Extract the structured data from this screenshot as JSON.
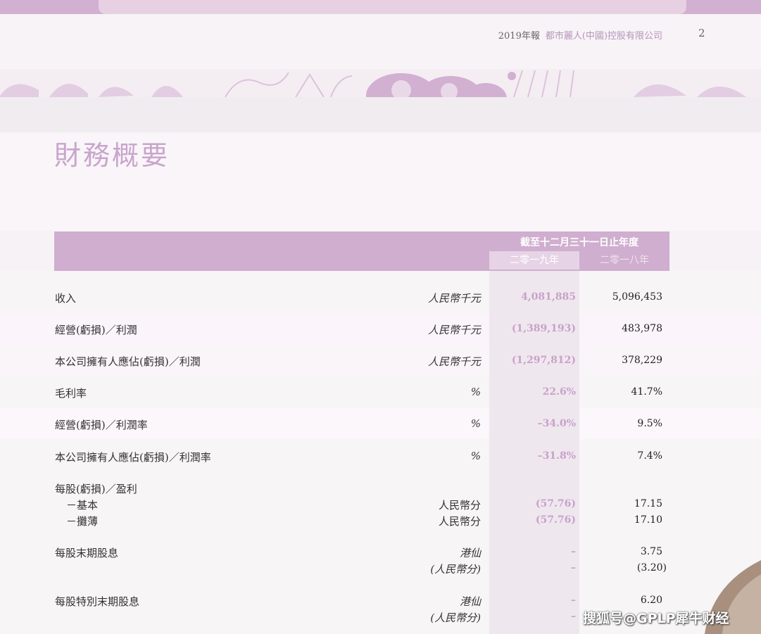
{
  "header": {
    "report": "2019年報",
    "company": "都市麗人(中國)控股有限公司",
    "page": "2"
  },
  "title": "財務概要",
  "table": {
    "period": "截至十二月三十一日止年度",
    "year_2019": "二零一九年",
    "year_2018": "二零一八年",
    "rows": [
      {
        "label": "收入",
        "unit": "人民幣千元",
        "v2019": "4,081,885",
        "v2018": "5,096,453"
      },
      {
        "label": "經營(虧損)／利潤",
        "unit": "人民幣千元",
        "v2019": "(1,389,193)",
        "v2018": "483,978"
      },
      {
        "label": "本公司擁有人應佔(虧損)／利潤",
        "unit": "人民幣千元",
        "v2019": "(1,297,812)",
        "v2018": "378,229"
      },
      {
        "label": "毛利率",
        "unit": "%",
        "v2019": "22.6%",
        "v2018": "41.7%"
      },
      {
        "label": "經營(虧損)／利潤率",
        "unit": "%",
        "v2019": "–34.0%",
        "v2018": "9.5%"
      },
      {
        "label": "本公司擁有人應佔(虧損)／利潤率",
        "unit": "%",
        "v2019": "–31.8%",
        "v2018": "7.4%"
      }
    ],
    "eps": {
      "label": "每股(虧損)／盈利",
      "basic": {
        "label": "－基本",
        "unit": "人民幣分",
        "v2019": "(57.76)",
        "v2018": "17.15"
      },
      "diluted": {
        "label": "－攤薄",
        "unit": "人民幣分",
        "v2019": "(57.76)",
        "v2018": "17.10"
      }
    },
    "final_dividend": {
      "label": "每股末期股息",
      "unit1": "港仙",
      "unit2": "(人民幣分)",
      "v2019_1": "–",
      "v2019_2": "–",
      "v2018_1": "3.75",
      "v2018_2": "(3.20)"
    },
    "special_dividend": {
      "label": "每股特別末期股息",
      "unit1": "港仙",
      "unit2": "(人民幣分)",
      "v2019_1": "–",
      "v2019_2": "–",
      "v2018_1": "6.20"
    }
  },
  "watermark": "搜狐号@GPLP犀牛财经",
  "colors": {
    "accent": "#cfaecf",
    "highlight_value": "#c8a1cb",
    "title": "#c9a5cd"
  }
}
